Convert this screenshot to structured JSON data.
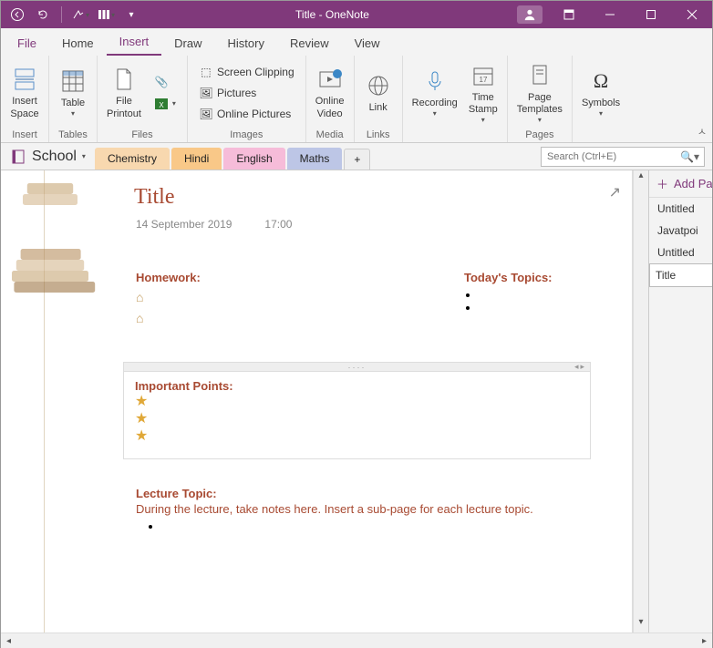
{
  "titlebar": {
    "title": "Title  -  OneNote"
  },
  "menus": {
    "file": "File",
    "home": "Home",
    "insert": "Insert",
    "draw": "Draw",
    "history": "History",
    "review": "Review",
    "view": "View"
  },
  "ribbon": {
    "insert_space": "Insert Space",
    "table": "Table",
    "file_printout": "File Printout",
    "screen_clipping": "Screen Clipping",
    "pictures": "Pictures",
    "online_pictures": "Online Pictures",
    "online_video": "Online Video",
    "link": "Link",
    "recording": "Recording",
    "time_stamp": "Time Stamp",
    "page_templates": "Page Templates",
    "symbols": "Symbols",
    "groups": {
      "insert": "Insert",
      "tables": "Tables",
      "files": "Files",
      "images": "Images",
      "media": "Media",
      "links": "Links",
      "pages": "Pages"
    }
  },
  "nav": {
    "notebook": "School",
    "tabs": [
      "Chemistry",
      "Hindi",
      "English",
      "Maths"
    ],
    "search_placeholder": "Search (Ctrl+E)"
  },
  "page": {
    "title": "Title",
    "date": "14 September 2019",
    "time": "17:00",
    "homework": "Homework:",
    "todays_topics": "Today's Topics:",
    "important_points": "Important Points:",
    "lecture_topic": "Lecture Topic:",
    "lecture_body": "During the lecture, take notes here.  Insert a sub-page for each lecture topic."
  },
  "pagelist": {
    "add": "Add Pa",
    "items": [
      "Untitled",
      "Javatpoi",
      "Untitled",
      "Title"
    ],
    "selected": 3
  }
}
